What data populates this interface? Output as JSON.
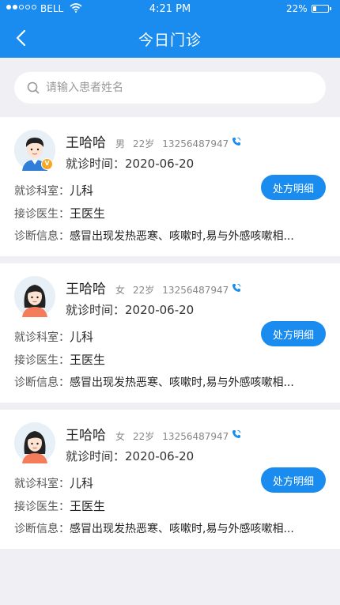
{
  "status_bar": {
    "carrier": "BELL",
    "time": "4:21 PM",
    "battery_percent": "22%",
    "battery_level": 0.22,
    "signal_bars": 2,
    "signal_total": 5
  },
  "header": {
    "title": "今日门诊",
    "background_color": "#1a8cf0"
  },
  "search": {
    "placeholder": "请输入患者姓名",
    "value": ""
  },
  "labels": {
    "visit_time": "就诊时间：",
    "department": "就诊科室：",
    "doctor": "接诊医生：",
    "diagnosis": "诊断信息：",
    "prescription_button": "处方明细"
  },
  "patients": [
    {
      "name": "王哈哈",
      "gender": "男",
      "age": "22岁",
      "phone": "13256487947",
      "visit_time": "2020-06-20",
      "department": "儿科",
      "doctor": "王医生",
      "diagnosis": "感冒出现发热恶寒、咳嗽时,易与外感咳嗽相...",
      "avatar_icon": "male-avatar-icon",
      "vip": true
    },
    {
      "name": "王哈哈",
      "gender": "女",
      "age": "22岁",
      "phone": "13256487947",
      "visit_time": "2020-06-20",
      "department": "儿科",
      "doctor": "王医生",
      "diagnosis": "感冒出现发热恶寒、咳嗽时,易与外感咳嗽相...",
      "avatar_icon": "female-avatar-icon",
      "vip": false
    },
    {
      "name": "王哈哈",
      "gender": "女",
      "age": "22岁",
      "phone": "13256487947",
      "visit_time": "2020-06-20",
      "department": "儿科",
      "doctor": "王医生",
      "diagnosis": "感冒出现发热恶寒、咳嗽时,易与外感咳嗽相...",
      "avatar_icon": "female-avatar-icon",
      "vip": false
    }
  ]
}
